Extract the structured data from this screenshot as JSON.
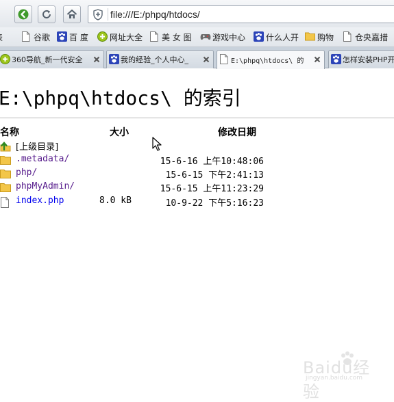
{
  "browser": {
    "url": "file:///E:/phpq/htdocs/",
    "nav": {
      "back": "arrow-left-icon",
      "reload": "reload-icon",
      "home": "home-icon"
    },
    "bookmarks": [
      {
        "label": "谷歌",
        "icon": "page-icon"
      },
      {
        "label": "百 度",
        "icon": "baidu-paw-icon"
      },
      {
        "label": "网址大全",
        "icon": "360-icon"
      },
      {
        "label": "美 女 图",
        "icon": "page-icon"
      },
      {
        "label": "游戏中心",
        "icon": "gamepad-icon"
      },
      {
        "label": "什么人开",
        "icon": "baidu-paw-icon"
      },
      {
        "label": "购物",
        "icon": "folder-icon"
      },
      {
        "label": "仓央嘉措",
        "icon": "page-icon"
      }
    ],
    "tabs": [
      {
        "label": "360导航_新一代安全",
        "active": false,
        "icon": "360-icon"
      },
      {
        "label": "我的经验_个人中心_",
        "active": false,
        "icon": "baidu-paw-icon"
      },
      {
        "label": "E:\\phpq\\htdocs\\ 的",
        "active": true,
        "icon": "page-icon"
      },
      {
        "label": "怎样安装PHP开",
        "active": false,
        "icon": "baidu-paw-icon"
      }
    ]
  },
  "page": {
    "title": "E:\\phpq\\htdocs\\ 的索引",
    "columns": {
      "name": "名称",
      "size": "大小",
      "modified": "修改日期"
    },
    "parent_link": "[上级目录]",
    "entries": [
      {
        "name": ".metadata/",
        "size": "",
        "date": "15-6-16 上午10:48:06",
        "type": "folder"
      },
      {
        "name": "php/",
        "size": "",
        "date": "15-6-15 下午2:41:13",
        "type": "folder"
      },
      {
        "name": "phpMyAdmin/",
        "size": "",
        "date": "15-6-15 上午11:23:29",
        "type": "folder"
      },
      {
        "name": "index.php",
        "size": "8.0 kB",
        "date": "10-9-22 下午5:16:23",
        "type": "file"
      }
    ]
  },
  "watermark": {
    "brand": "Baidu经验",
    "domain": "jingyan.baidu.com"
  },
  "colors": {
    "folder": "#f3c649",
    "link": "#0000ee",
    "visited": "#551a8b",
    "accent": "#2f8a21"
  }
}
